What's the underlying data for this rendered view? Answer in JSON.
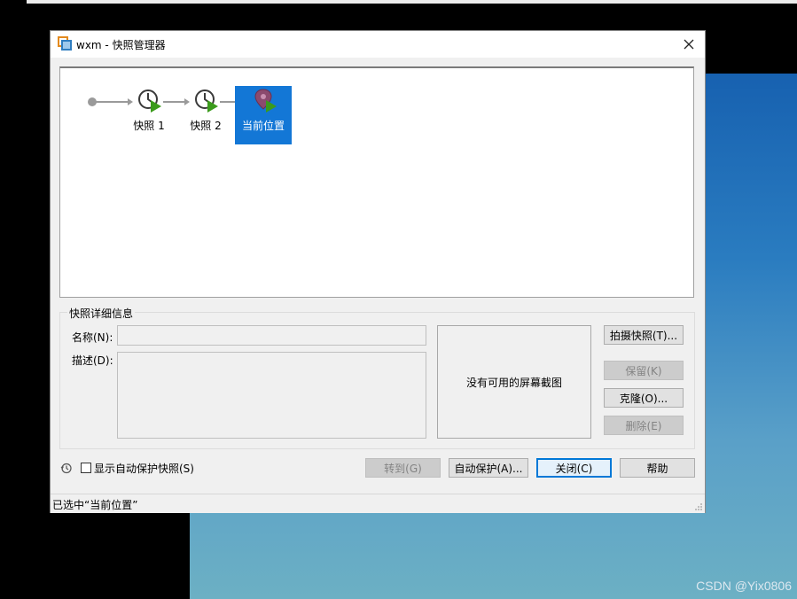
{
  "window": {
    "title": "wxm - 快照管理器",
    "close_symbol": "✕"
  },
  "snapshot_tree": {
    "nodes": [
      {
        "label": "快照 1",
        "icon": "snapshot-clock-icon"
      },
      {
        "label": "快照 2",
        "icon": "snapshot-clock-icon"
      },
      {
        "label": "当前位置",
        "icon": "current-location-pin-icon",
        "selected": true
      }
    ]
  },
  "details": {
    "group_title": "快照详细信息",
    "name_label": "名称(N):",
    "name_value": "",
    "description_label": "描述(D):",
    "description_value": "",
    "screenshot_text": "没有可用的屏幕截图"
  },
  "side_buttons": {
    "take": "拍摄快照(T)...",
    "keep": "保留(K)",
    "clone": "克隆(O)...",
    "delete": "删除(E)"
  },
  "bottom": {
    "show_autoprotect_label": "显示自动保护快照(S)",
    "show_autoprotect_checked": false,
    "goto": "转到(G)",
    "autoprotect": "自动保护(A)...",
    "close": "关闭(C)",
    "help": "帮助"
  },
  "status": {
    "text": "已选中“当前位置”"
  },
  "watermark": "CSDN @Yix0806",
  "colors": {
    "selection": "#1377d6",
    "play_green": "#3b9b1c",
    "default_button_border": "#0078d7"
  }
}
